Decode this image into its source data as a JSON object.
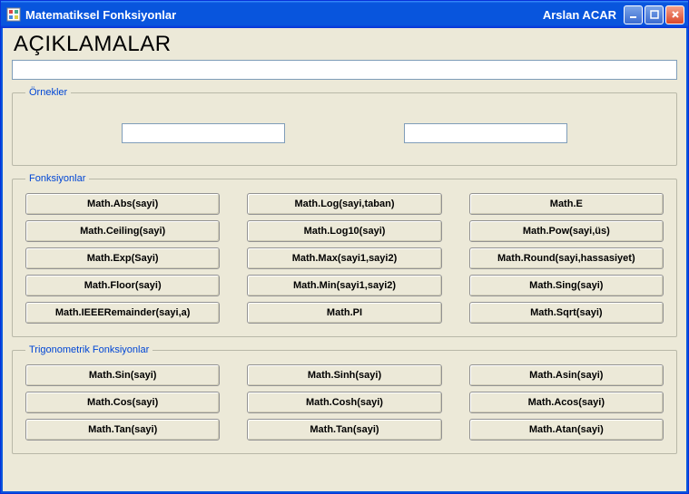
{
  "window": {
    "title": "Matematiksel Fonksiyonlar",
    "user": "Arslan ACAR"
  },
  "headings": {
    "description": "AÇIKLAMALAR"
  },
  "groups": {
    "examples": "Örnekler",
    "functions": "Fonksiyonlar",
    "trig": "Trigonometrik Fonksiyonlar"
  },
  "inputs": {
    "description": "",
    "example_left": "",
    "example_right": ""
  },
  "functions": {
    "col1": [
      "Math.Abs(sayi)",
      "Math.Ceiling(sayi)",
      "Math.Exp(Sayi)",
      "Math.Floor(sayi)",
      "Math.IEEERemainder(sayi,a)"
    ],
    "col2": [
      "Math.Log(sayi,taban)",
      "Math.Log10(sayi)",
      "Math.Max(sayi1,sayi2)",
      "Math.Min(sayi1,sayi2)",
      "Math.PI"
    ],
    "col3": [
      "Math.E",
      "Math.Pow(sayi,üs)",
      "Math.Round(sayi,hassasiyet)",
      "Math.Sing(sayi)",
      "Math.Sqrt(sayi)"
    ]
  },
  "trig": {
    "col1": [
      "Math.Sin(sayi)",
      "Math.Cos(sayi)",
      "Math.Tan(sayi)"
    ],
    "col2": [
      "Math.Sinh(sayi)",
      "Math.Cosh(sayi)",
      "Math.Tan(sayi)"
    ],
    "col3": [
      "Math.Asin(sayi)",
      "Math.Acos(sayi)",
      "Math.Atan(sayi)"
    ]
  }
}
